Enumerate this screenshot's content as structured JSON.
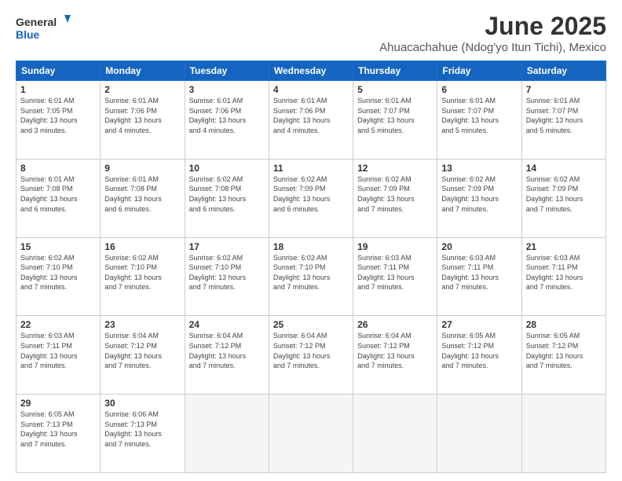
{
  "logo": {
    "line1": "General",
    "line2": "Blue"
  },
  "title": "June 2025",
  "location": "Ahuacachahue (Ndog'yo Itun Tichi), Mexico",
  "days_of_week": [
    "Sunday",
    "Monday",
    "Tuesday",
    "Wednesday",
    "Thursday",
    "Friday",
    "Saturday"
  ],
  "weeks": [
    [
      {
        "day": "1",
        "sunrise": "6:01 AM",
        "sunset": "7:05 PM",
        "daylight": "13 hours and 3 minutes."
      },
      {
        "day": "2",
        "sunrise": "6:01 AM",
        "sunset": "7:06 PM",
        "daylight": "13 hours and 4 minutes."
      },
      {
        "day": "3",
        "sunrise": "6:01 AM",
        "sunset": "7:06 PM",
        "daylight": "13 hours and 4 minutes."
      },
      {
        "day": "4",
        "sunrise": "6:01 AM",
        "sunset": "7:06 PM",
        "daylight": "13 hours and 4 minutes."
      },
      {
        "day": "5",
        "sunrise": "6:01 AM",
        "sunset": "7:07 PM",
        "daylight": "13 hours and 5 minutes."
      },
      {
        "day": "6",
        "sunrise": "6:01 AM",
        "sunset": "7:07 PM",
        "daylight": "13 hours and 5 minutes."
      },
      {
        "day": "7",
        "sunrise": "6:01 AM",
        "sunset": "7:07 PM",
        "daylight": "13 hours and 5 minutes."
      }
    ],
    [
      {
        "day": "8",
        "sunrise": "6:01 AM",
        "sunset": "7:08 PM",
        "daylight": "13 hours and 6 minutes."
      },
      {
        "day": "9",
        "sunrise": "6:01 AM",
        "sunset": "7:08 PM",
        "daylight": "13 hours and 6 minutes."
      },
      {
        "day": "10",
        "sunrise": "6:02 AM",
        "sunset": "7:08 PM",
        "daylight": "13 hours and 6 minutes."
      },
      {
        "day": "11",
        "sunrise": "6:02 AM",
        "sunset": "7:09 PM",
        "daylight": "13 hours and 6 minutes."
      },
      {
        "day": "12",
        "sunrise": "6:02 AM",
        "sunset": "7:09 PM",
        "daylight": "13 hours and 7 minutes."
      },
      {
        "day": "13",
        "sunrise": "6:02 AM",
        "sunset": "7:09 PM",
        "daylight": "13 hours and 7 minutes."
      },
      {
        "day": "14",
        "sunrise": "6:02 AM",
        "sunset": "7:09 PM",
        "daylight": "13 hours and 7 minutes."
      }
    ],
    [
      {
        "day": "15",
        "sunrise": "6:02 AM",
        "sunset": "7:10 PM",
        "daylight": "13 hours and 7 minutes."
      },
      {
        "day": "16",
        "sunrise": "6:02 AM",
        "sunset": "7:10 PM",
        "daylight": "13 hours and 7 minutes."
      },
      {
        "day": "17",
        "sunrise": "6:02 AM",
        "sunset": "7:10 PM",
        "daylight": "13 hours and 7 minutes."
      },
      {
        "day": "18",
        "sunrise": "6:03 AM",
        "sunset": "7:10 PM",
        "daylight": "13 hours and 7 minutes."
      },
      {
        "day": "19",
        "sunrise": "6:03 AM",
        "sunset": "7:11 PM",
        "daylight": "13 hours and 7 minutes."
      },
      {
        "day": "20",
        "sunrise": "6:03 AM",
        "sunset": "7:11 PM",
        "daylight": "13 hours and 7 minutes."
      },
      {
        "day": "21",
        "sunrise": "6:03 AM",
        "sunset": "7:11 PM",
        "daylight": "13 hours and 7 minutes."
      }
    ],
    [
      {
        "day": "22",
        "sunrise": "6:03 AM",
        "sunset": "7:11 PM",
        "daylight": "13 hours and 7 minutes."
      },
      {
        "day": "23",
        "sunrise": "6:04 AM",
        "sunset": "7:12 PM",
        "daylight": "13 hours and 7 minutes."
      },
      {
        "day": "24",
        "sunrise": "6:04 AM",
        "sunset": "7:12 PM",
        "daylight": "13 hours and 7 minutes."
      },
      {
        "day": "25",
        "sunrise": "6:04 AM",
        "sunset": "7:12 PM",
        "daylight": "13 hours and 7 minutes."
      },
      {
        "day": "26",
        "sunrise": "6:04 AM",
        "sunset": "7:12 PM",
        "daylight": "13 hours and 7 minutes."
      },
      {
        "day": "27",
        "sunrise": "6:05 AM",
        "sunset": "7:12 PM",
        "daylight": "13 hours and 7 minutes."
      },
      {
        "day": "28",
        "sunrise": "6:05 AM",
        "sunset": "7:12 PM",
        "daylight": "13 hours and 7 minutes."
      }
    ],
    [
      {
        "day": "29",
        "sunrise": "6:05 AM",
        "sunset": "7:13 PM",
        "daylight": "13 hours and 7 minutes."
      },
      {
        "day": "30",
        "sunrise": "6:06 AM",
        "sunset": "7:13 PM",
        "daylight": "13 hours and 7 minutes."
      },
      null,
      null,
      null,
      null,
      null
    ]
  ],
  "labels": {
    "sunrise": "Sunrise:",
    "sunset": "Sunset:",
    "daylight": "Daylight:"
  }
}
